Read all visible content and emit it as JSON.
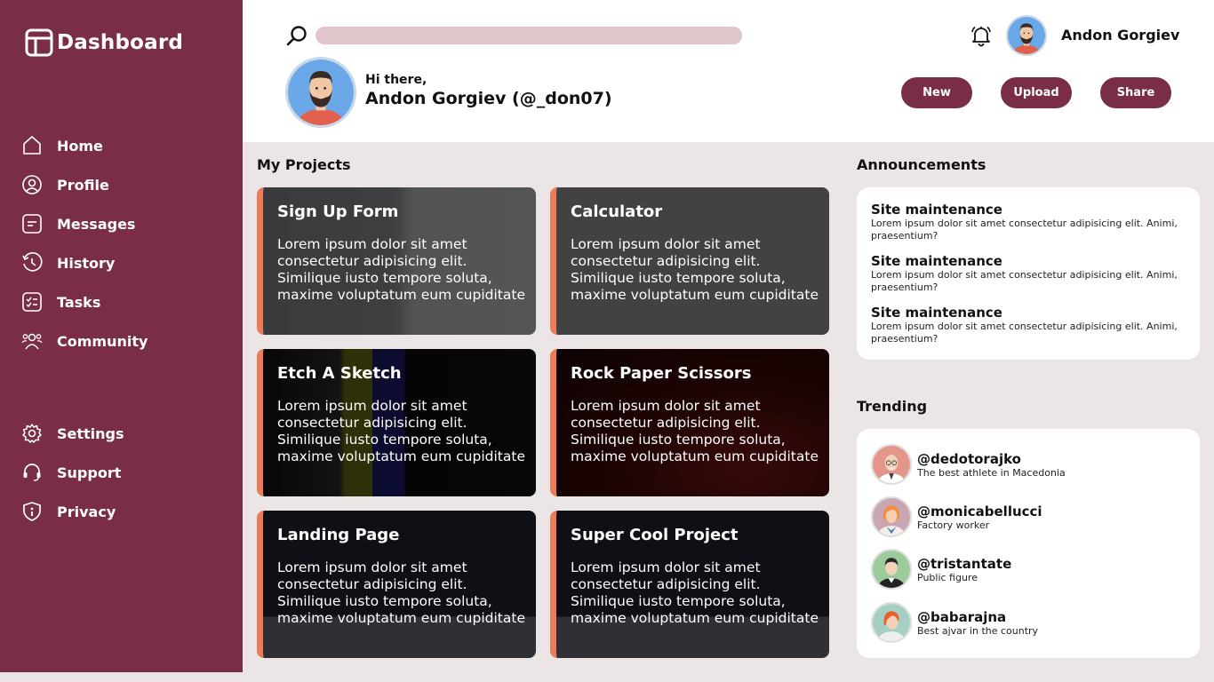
{
  "sidebar": {
    "brand": "Dashboard",
    "items": [
      {
        "label": "Home",
        "icon": "home-icon"
      },
      {
        "label": "Profile",
        "icon": "profile-icon"
      },
      {
        "label": "Messages",
        "icon": "messages-icon"
      },
      {
        "label": "History",
        "icon": "history-icon"
      },
      {
        "label": "Tasks",
        "icon": "tasks-icon"
      },
      {
        "label": "Community",
        "icon": "community-icon"
      }
    ],
    "bottom_items": [
      {
        "label": "Settings",
        "icon": "gear-icon"
      },
      {
        "label": "Support",
        "icon": "headset-icon"
      },
      {
        "label": "Privacy",
        "icon": "shield-icon"
      }
    ]
  },
  "header": {
    "search_value": "",
    "user_name": "Andon Gorgiev",
    "greeting_small": "Hi there,",
    "greeting_big": "Andon Gorgiev (@_don07)",
    "buttons": {
      "new": "New",
      "upload": "Upload",
      "share": "Share"
    }
  },
  "projects": {
    "title": "My Projects",
    "cards": [
      {
        "title": "Sign Up Form",
        "desc": "Lorem ipsum dolor sit amet consectetur adipisicing elit. Similique iusto tempore soluta, maxime voluptatum eum cupiditate"
      },
      {
        "title": "Calculator",
        "desc": "Lorem ipsum dolor sit amet consectetur adipisicing elit. Similique iusto tempore soluta, maxime voluptatum eum cupiditate"
      },
      {
        "title": "Etch A Sketch",
        "desc": "Lorem ipsum dolor sit amet consectetur adipisicing elit. Similique iusto tempore soluta, maxime voluptatum eum cupiditate"
      },
      {
        "title": "Rock Paper Scissors",
        "desc": "Lorem ipsum dolor sit amet consectetur adipisicing elit. Similique iusto tempore soluta, maxime voluptatum eum cupiditate"
      },
      {
        "title": "Landing Page",
        "desc": "Lorem ipsum dolor sit amet consectetur adipisicing elit. Similique iusto tempore soluta, maxime voluptatum eum cupiditate"
      },
      {
        "title": "Super Cool Project",
        "desc": "Lorem ipsum dolor sit amet consectetur adipisicing elit. Similique iusto tempore soluta, maxime voluptatum eum cupiditate"
      }
    ]
  },
  "announcements": {
    "title": "Announcements",
    "items": [
      {
        "title": "Site maintenance",
        "text": "Lorem ipsum dolor sit amet consectetur adipisicing elit. Animi, praesentium?"
      },
      {
        "title": "Site maintenance",
        "text": "Lorem ipsum dolor sit amet consectetur adipisicing elit. Animi, praesentium?"
      },
      {
        "title": "Site maintenance",
        "text": "Lorem ipsum dolor sit amet consectetur adipisicing elit. Animi, praesentium?"
      }
    ]
  },
  "trending": {
    "title": "Trending",
    "items": [
      {
        "handle": "@dedotorajko",
        "desc": "The best athlete in Macedonia"
      },
      {
        "handle": "@monicabellucci",
        "desc": "Factory worker"
      },
      {
        "handle": "@tristantate",
        "desc": "Public figure"
      },
      {
        "handle": "@babarajna",
        "desc": "Best ajvar in the country"
      }
    ]
  },
  "colors": {
    "brand": "#7a2d46",
    "accent": "#ee7b57",
    "search": "#e0c5cb",
    "background": "#ebe5e6"
  }
}
